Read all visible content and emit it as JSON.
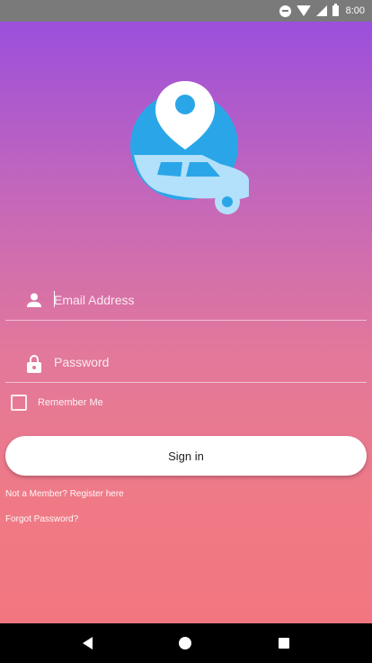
{
  "status_bar": {
    "time": "8:00"
  },
  "login": {
    "email_placeholder": "Email Address",
    "password_placeholder": "Password",
    "remember_label": "Remember Me",
    "remember_checked": false,
    "signin_label": "Sign in",
    "register_link": "Not a Member? Register here",
    "forgot_link": "Forgot Password?"
  },
  "icons": {
    "logo": "map-pin-with-car-icon",
    "email": "person-icon",
    "password": "lock-icon"
  },
  "colors": {
    "gradient_top": "#9b4fdc",
    "gradient_bottom": "#f27680",
    "logo_circle": "#2aa6e8",
    "logo_car": "#b3e0fb"
  }
}
